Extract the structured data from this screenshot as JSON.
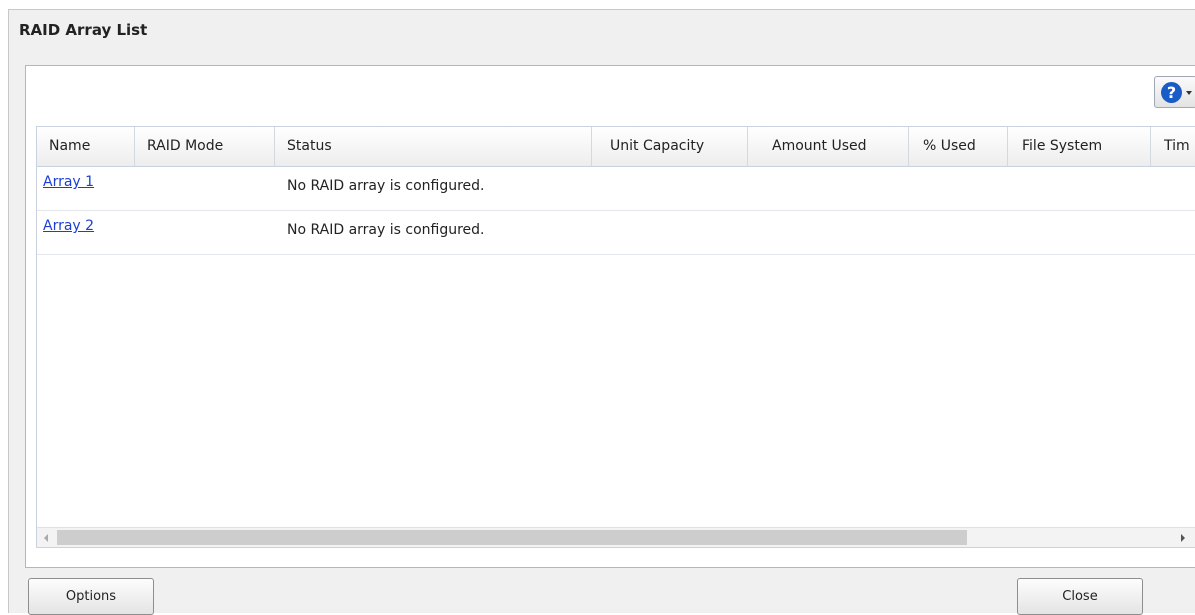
{
  "dialog": {
    "title": "RAID Array List"
  },
  "help": {
    "icon": "question-circle-icon",
    "glyph": "?",
    "accent": "#1a5cc7"
  },
  "table": {
    "columns": [
      "Name",
      "RAID Mode",
      "Status",
      "Unit Capacity",
      "Amount Used",
      "% Used",
      "File System",
      "Tim"
    ],
    "rows": [
      {
        "name": "Array 1",
        "raid_mode": "",
        "status": "No RAID array is configured."
      },
      {
        "name": "Array 2",
        "raid_mode": "",
        "status": "No RAID array is configured."
      }
    ],
    "link_color": "#1b3fd6"
  },
  "footer": {
    "options_label": "Options",
    "close_label": "Close"
  }
}
